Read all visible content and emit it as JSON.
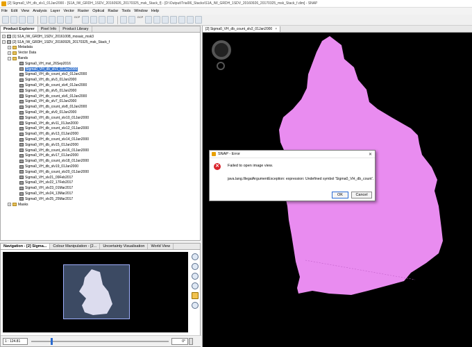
{
  "window": {
    "title": "[2] Sigma0_VH_db_slv1_01Jan2000 - [S1A_IW_GRDH_1SDV_20160926_20170325_msk_Stack_f] - [D:\\Output\\Trial06_Stacks\\S1A_IW_GRDH_1SDV_20160926_20170325_msk_Stack_f.dim] - SNAP"
  },
  "menu": [
    "File",
    "Edit",
    "View",
    "Analysis",
    "Layer",
    "Vector",
    "Raster",
    "Optical",
    "Radar",
    "Tools",
    "Window",
    "Help"
  ],
  "toolbar": {
    "gcp1": "GCP",
    "gcp2": "GCP"
  },
  "product_explorer": {
    "tabs": [
      "Product Explorer",
      "Pixel Info",
      "Product Library"
    ],
    "products": [
      "[1] S1A_IW_GRDH_1SDV_20161008_mosaic_msk3",
      "[2] S1A_IW_GRDH_1SDV_20160926_20170325_msk_Stack_f"
    ],
    "folders": [
      "Metadata",
      "Vector Data",
      "Bands",
      "Masks"
    ],
    "bands": [
      "Sigma0_VH_mst_26Sep2016",
      "Sigma0_VH_db_slv1_01Jan2000",
      "Sigma0_VH_db_count_slv2_01Jan2000",
      "Sigma0_VH_db_slv3_01Jan2000",
      "Sigma0_VH_db_count_slv4_01Jan2000",
      "Sigma0_VH_db_slv5_01Jan2000",
      "Sigma0_VH_db_count_slv6_01Jan2000",
      "Sigma0_VH_db_slv7_01Jan2000",
      "Sigma0_VH_db_count_slv8_01Jan2000",
      "Sigma0_VH_db_slv9_01Jan2000",
      "Sigma0_VH_db_count_slv10_01Jan2000",
      "Sigma0_VH_db_slv11_01Jan2000",
      "Sigma0_VH_db_count_slv12_01Jan2000",
      "Sigma0_VH_db_slv13_01Jan2000",
      "Sigma0_VH_db_count_slv14_01Jan2000",
      "Sigma0_VH_db_slv15_01Jan2000",
      "Sigma0_VH_db_count_slv16_01Jan2000",
      "Sigma0_VH_db_slv17_01Jan2000",
      "Sigma0_VH_db_count_slv18_01Jan2000",
      "Sigma0_VH_db_slv19_01Jan2000",
      "Sigma0_VH_db_count_slv20_01Jan2000",
      "Sigma0_VH_slv21_09Feb2017",
      "Sigma0_VH_slv22_17Feb2017",
      "Sigma0_VH_slv23_01Mar2017",
      "Sigma0_VH_slv24_13Mar2017",
      "Sigma0_VH_slv25_25Mar2017"
    ]
  },
  "navigation": {
    "tabs": [
      "Navigation - [2] Sigma...",
      "Colour Manipulation - [2...",
      "Uncertainty Visualisation",
      "World View"
    ],
    "zoom": "1 : 124.81",
    "angle": "0°",
    "zoom_fraction": 0.14
  },
  "image_view": {
    "tab": "[2] Sigma0_VH_db_count_slv2_01Jan2000",
    "fill_color": "#e98cf0"
  },
  "dialog": {
    "title": "SNAP - Error",
    "message": "Failed to open image view.",
    "detail": "java.lang.IllegalArgumentException: expression: Undefined symbol 'Sigma0_VH_db_count'.",
    "ok": "OK",
    "cancel": "Cancel"
  }
}
